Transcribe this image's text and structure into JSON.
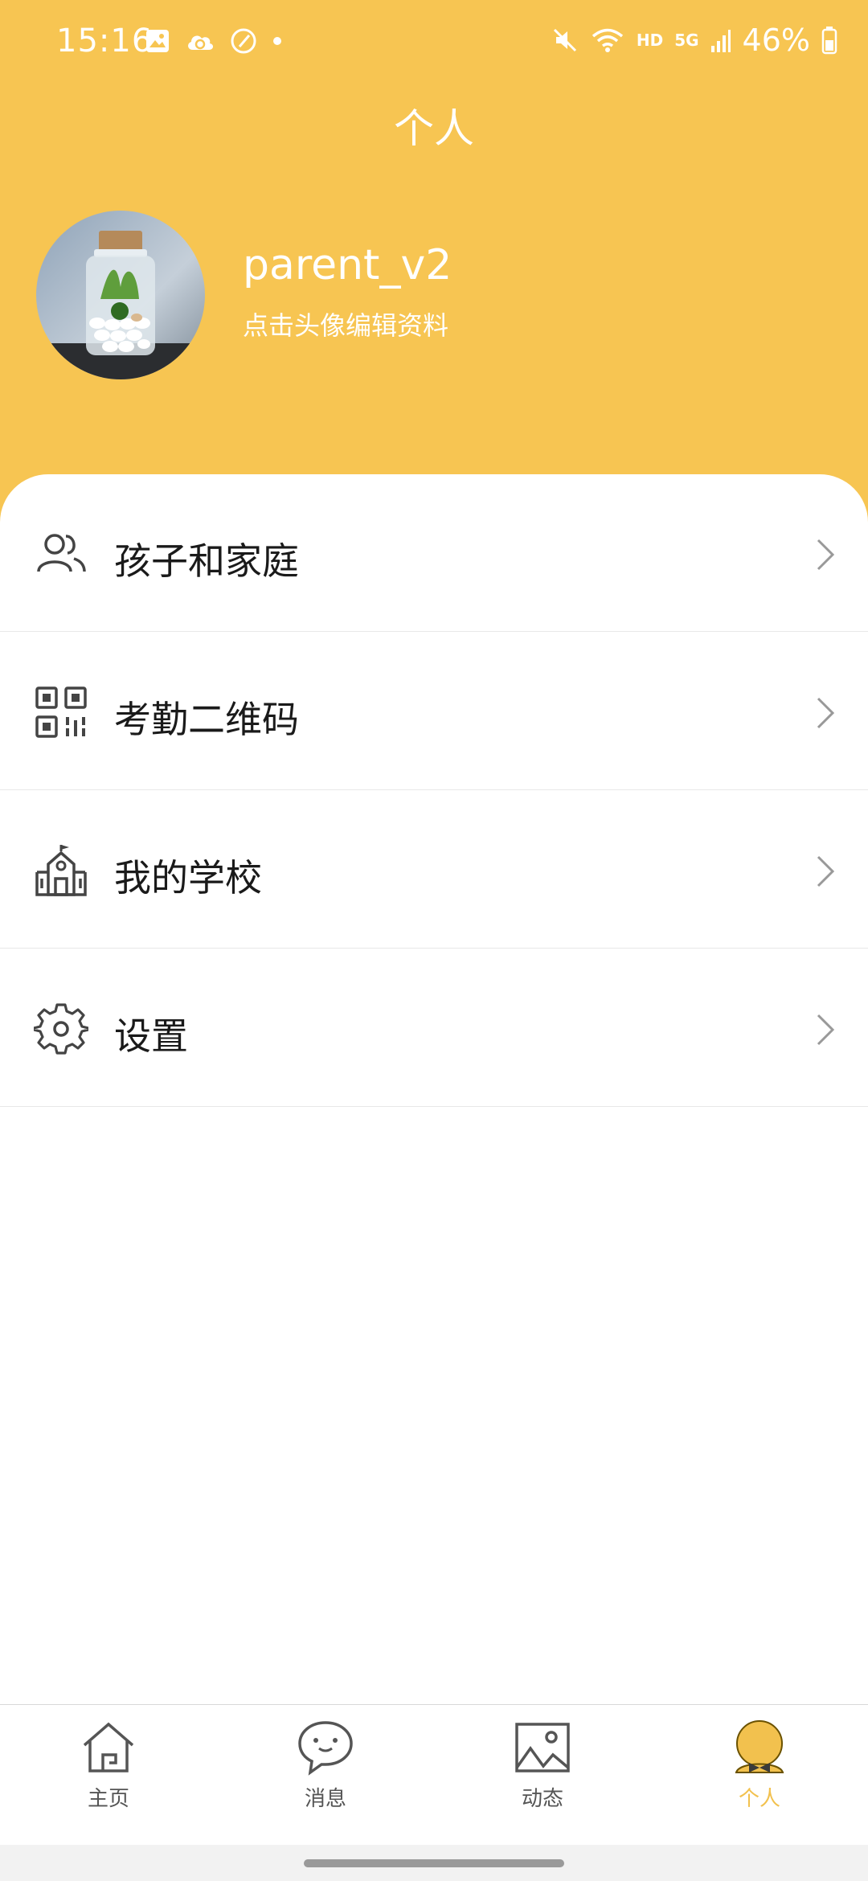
{
  "status": {
    "time": "15:16",
    "hd": "HD",
    "net": "5G",
    "battery": "46%"
  },
  "header": {
    "title": "个人"
  },
  "profile": {
    "username": "parent_v2",
    "edit_hint": "点击头像编辑资料"
  },
  "menu": {
    "items": [
      {
        "label": "孩子和家庭",
        "icon": "people-icon"
      },
      {
        "label": "考勤二维码",
        "icon": "qr-code-icon"
      },
      {
        "label": "我的学校",
        "icon": "school-icon"
      },
      {
        "label": "设置",
        "icon": "gear-icon"
      }
    ]
  },
  "tabs": [
    {
      "label": "主页",
      "icon": "home-icon"
    },
    {
      "label": "消息",
      "icon": "chat-icon"
    },
    {
      "label": "动态",
      "icon": "image-icon"
    },
    {
      "label": "个人",
      "icon": "profile-icon",
      "active": true
    }
  ],
  "colors": {
    "brand": "#F7C552",
    "tab_active": "#F2C14E"
  }
}
